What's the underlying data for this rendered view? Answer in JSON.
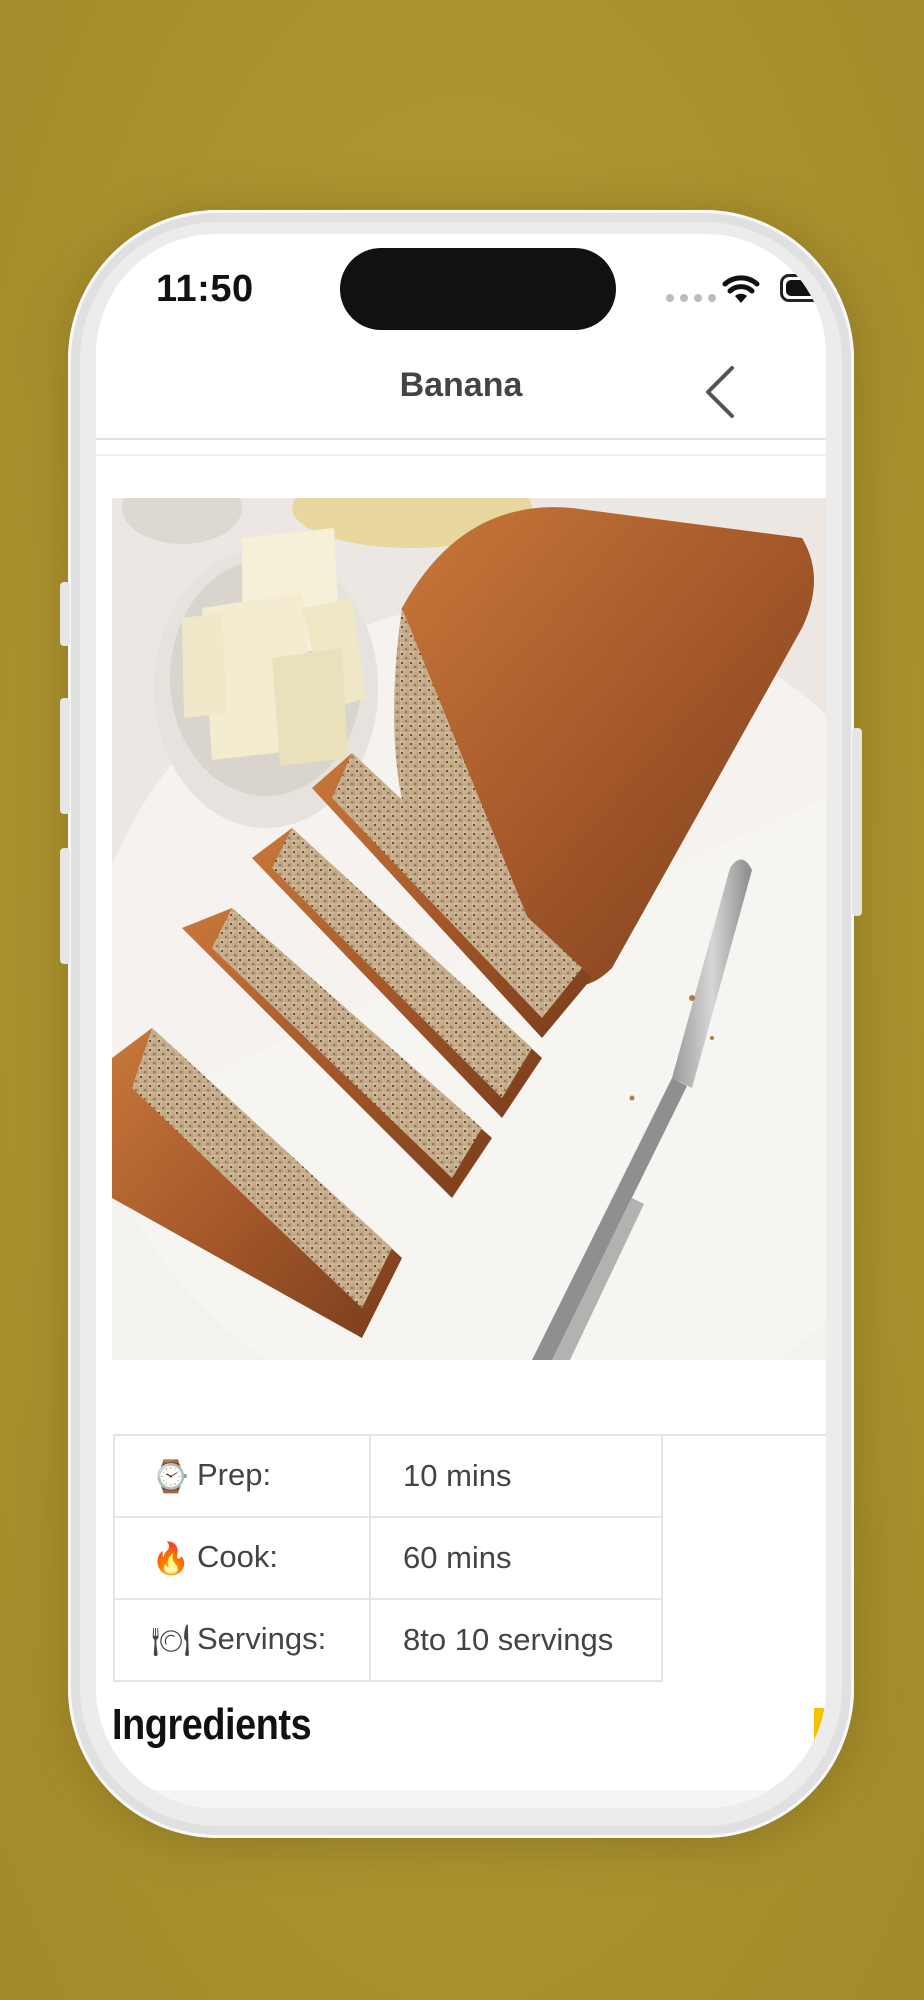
{
  "status_bar": {
    "time": "11:50"
  },
  "nav": {
    "title": "Banana"
  },
  "recipe_info": [
    {
      "icon": "watch-icon",
      "emoji": "⌚",
      "label": "Prep:",
      "value": "10 mins"
    },
    {
      "icon": "fire-icon",
      "emoji": "🔥",
      "label": "Cook:",
      "value": "60 mins"
    },
    {
      "icon": "plate-icon",
      "emoji": "🍽",
      "label": "Servings:",
      "value": "8to 10 servings"
    }
  ],
  "ingredients_heading": "Ingredients",
  "colors": {
    "background": "#ad9532",
    "accent": "#f3c300",
    "text": "#444444"
  }
}
